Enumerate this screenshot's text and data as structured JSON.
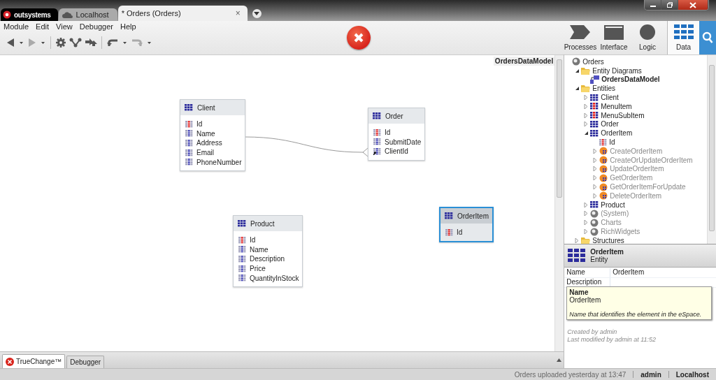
{
  "window": {
    "tabs": [
      {
        "kind": "logo",
        "label": "outsystems",
        "selected": false
      },
      {
        "kind": "server",
        "label": "Localhost",
        "selected": false
      },
      {
        "kind": "module",
        "label": "* Orders (Orders)",
        "selected": true,
        "close": "×"
      }
    ]
  },
  "menu": [
    "Module",
    "Edit",
    "View",
    "Debugger",
    "Help"
  ],
  "error_indicator": {
    "kind": "error"
  },
  "layers": [
    {
      "label": "Processes",
      "kind": "processes",
      "selected": false
    },
    {
      "label": "Interface",
      "kind": "interface",
      "selected": false
    },
    {
      "label": "Logic",
      "kind": "logic",
      "selected": false
    },
    {
      "label": "Data",
      "kind": "data",
      "selected": true
    }
  ],
  "canvas": {
    "title": "OrdersDataModel",
    "entities": [
      {
        "name": "Client",
        "selected": false,
        "attributes": [
          {
            "name": "Id",
            "kind": "identifier"
          },
          {
            "name": "Name",
            "kind": "attribute"
          },
          {
            "name": "Address",
            "kind": "attribute"
          },
          {
            "name": "Email",
            "kind": "attribute"
          },
          {
            "name": "PhoneNumber",
            "kind": "attribute"
          }
        ]
      },
      {
        "name": "Order",
        "selected": false,
        "attributes": [
          {
            "name": "Id",
            "kind": "identifier"
          },
          {
            "name": "SubmitDate",
            "kind": "attribute"
          },
          {
            "name": "ClientId",
            "kind": "foreign_key"
          }
        ]
      },
      {
        "name": "Product",
        "selected": false,
        "attributes": [
          {
            "name": "Id",
            "kind": "identifier"
          },
          {
            "name": "Name",
            "kind": "attribute"
          },
          {
            "name": "Description",
            "kind": "attribute"
          },
          {
            "name": "Price",
            "kind": "attribute"
          },
          {
            "name": "QuantityInStock",
            "kind": "attribute"
          }
        ]
      },
      {
        "name": "OrderItem",
        "selected": true,
        "attributes": [
          {
            "name": "Id",
            "kind": "identifier"
          }
        ]
      }
    ]
  },
  "tree": [
    {
      "label": "Orders",
      "kind": "module",
      "children": [
        {
          "label": "Entity Diagrams",
          "kind": "folder",
          "expanded": true,
          "children": [
            {
              "label": "OrdersDataModel",
              "kind": "diagram"
            }
          ]
        },
        {
          "label": "Entities",
          "kind": "folder",
          "expanded": true,
          "children": [
            {
              "label": "Client",
              "kind": "entity",
              "expanded": false
            },
            {
              "label": "MenuItem",
              "kind": "static_entity",
              "expanded": false
            },
            {
              "label": "MenuSubItem",
              "kind": "static_entity",
              "expanded": false
            },
            {
              "label": "Order",
              "kind": "entity",
              "expanded": false
            },
            {
              "label": "OrderItem",
              "kind": "entity",
              "expanded": true,
              "children": [
                {
                  "label": "Id",
                  "kind": "identifier"
                },
                {
                  "label": "CreateOrderItem",
                  "kind": "action",
                  "expanded": false
                },
                {
                  "label": "CreateOrUpdateOrderItem",
                  "kind": "action",
                  "expanded": false
                },
                {
                  "label": "UpdateOrderItem",
                  "kind": "action",
                  "expanded": false
                },
                {
                  "label": "GetOrderItem",
                  "kind": "action",
                  "expanded": false
                },
                {
                  "label": "GetOrderItemForUpdate",
                  "kind": "action",
                  "expanded": false
                },
                {
                  "label": "DeleteOrderItem",
                  "kind": "action",
                  "expanded": false
                }
              ]
            },
            {
              "label": "Product",
              "kind": "entity",
              "expanded": false
            },
            {
              "label": "(System)",
              "kind": "reference",
              "expanded": false
            },
            {
              "label": "Charts",
              "kind": "reference",
              "expanded": false
            },
            {
              "label": "RichWidgets",
              "kind": "reference",
              "expanded": false
            }
          ]
        },
        {
          "label": "Structures",
          "kind": "folder",
          "expanded": false
        }
      ]
    }
  ],
  "properties": {
    "title": "OrderItem",
    "subtitle": "Entity",
    "rows": [
      {
        "label": "Name",
        "value": "OrderItem"
      },
      {
        "label": "Description"
      }
    ],
    "tooltip": {
      "title": "Name",
      "value": "OrderItem",
      "hint": "Name that identifies the element in the eSpace."
    },
    "created": "Created by admin",
    "modified": "Last modified by admin at 11:52"
  },
  "bottom_tabs": [
    {
      "label": "TrueChange™",
      "kind": "error",
      "selected": true
    },
    {
      "label": "Debugger",
      "kind": "plain",
      "selected": false
    }
  ],
  "status_bar": {
    "message": "Orders uploaded yesterday at 13:47",
    "user": "admin",
    "server": "Localhost"
  }
}
